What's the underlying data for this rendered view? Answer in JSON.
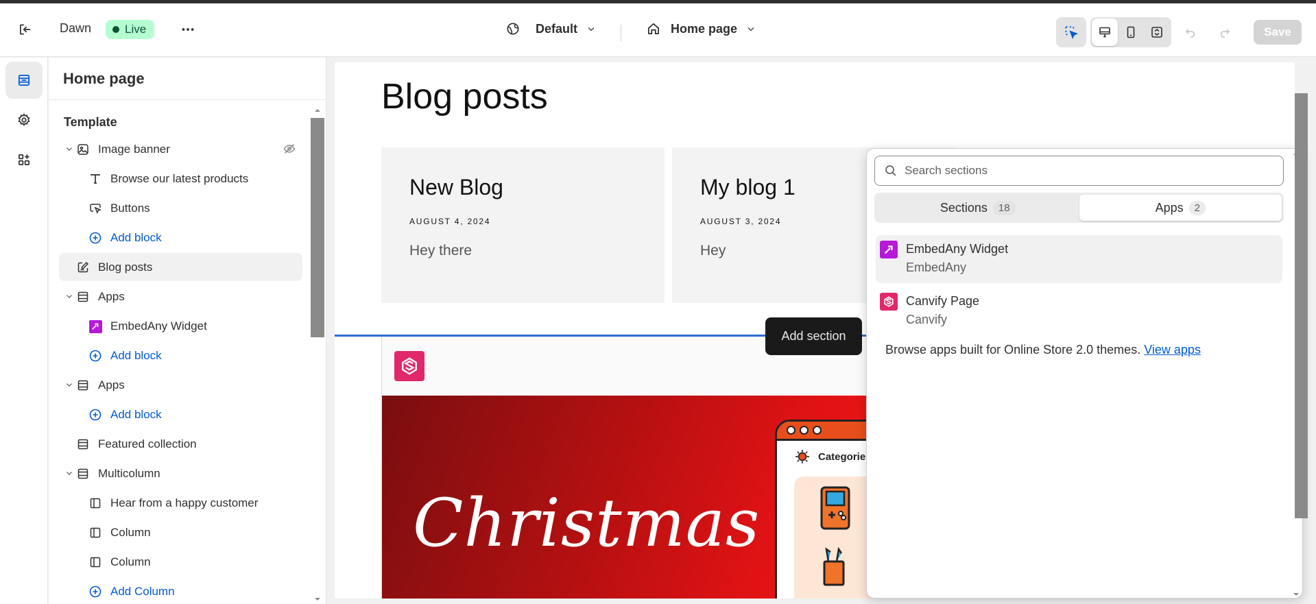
{
  "topbar": {
    "theme_name": "Dawn",
    "status_badge": "Live",
    "theme_selector": "Default",
    "page_selector": "Home page",
    "save_label": "Save"
  },
  "panel": {
    "title": "Home page",
    "template_heading": "Template",
    "rows": {
      "image_banner": "Image banner",
      "browse_products": "Browse our latest products",
      "buttons": "Buttons",
      "add_block_1": "Add block",
      "blog_posts": "Blog posts",
      "apps_1": "Apps",
      "embedany_widget": "EmbedAny Widget",
      "add_block_2": "Add block",
      "apps_2": "Apps",
      "add_block_3": "Add block",
      "featured_collection": "Featured collection",
      "multicolumn": "Multicolumn",
      "happy_customer": "Hear from a happy customer",
      "column_1": "Column",
      "column_2": "Column",
      "add_column": "Add Column"
    }
  },
  "preview": {
    "blog_heading": "Blog posts",
    "cards": [
      {
        "title": "New Blog",
        "date": "AUGUST 4, 2024",
        "excerpt": "Hey there"
      },
      {
        "title": "My blog 1",
        "date": "AUGUST 3, 2024",
        "excerpt": "Hey"
      }
    ],
    "banner_text": "Christmas",
    "device_category": "Categorie",
    "add_section_tooltip": "Add section"
  },
  "popover": {
    "search_placeholder": "Search sections",
    "tabs": [
      {
        "label": "Sections",
        "count": "18"
      },
      {
        "label": "Apps",
        "count": "2"
      }
    ],
    "items": [
      {
        "name": "EmbedAny Widget",
        "vendor": "EmbedAny"
      },
      {
        "name": "Canvify Page",
        "vendor": "Canvify"
      }
    ],
    "footer_text": "Browse apps built for Online Store 2.0 themes.",
    "footer_link": "View apps"
  },
  "colors": {
    "accent": "#005bd3",
    "live_badge": "#b4fed2",
    "canvify": "#e0286a",
    "embedany": "#b51bd6"
  }
}
